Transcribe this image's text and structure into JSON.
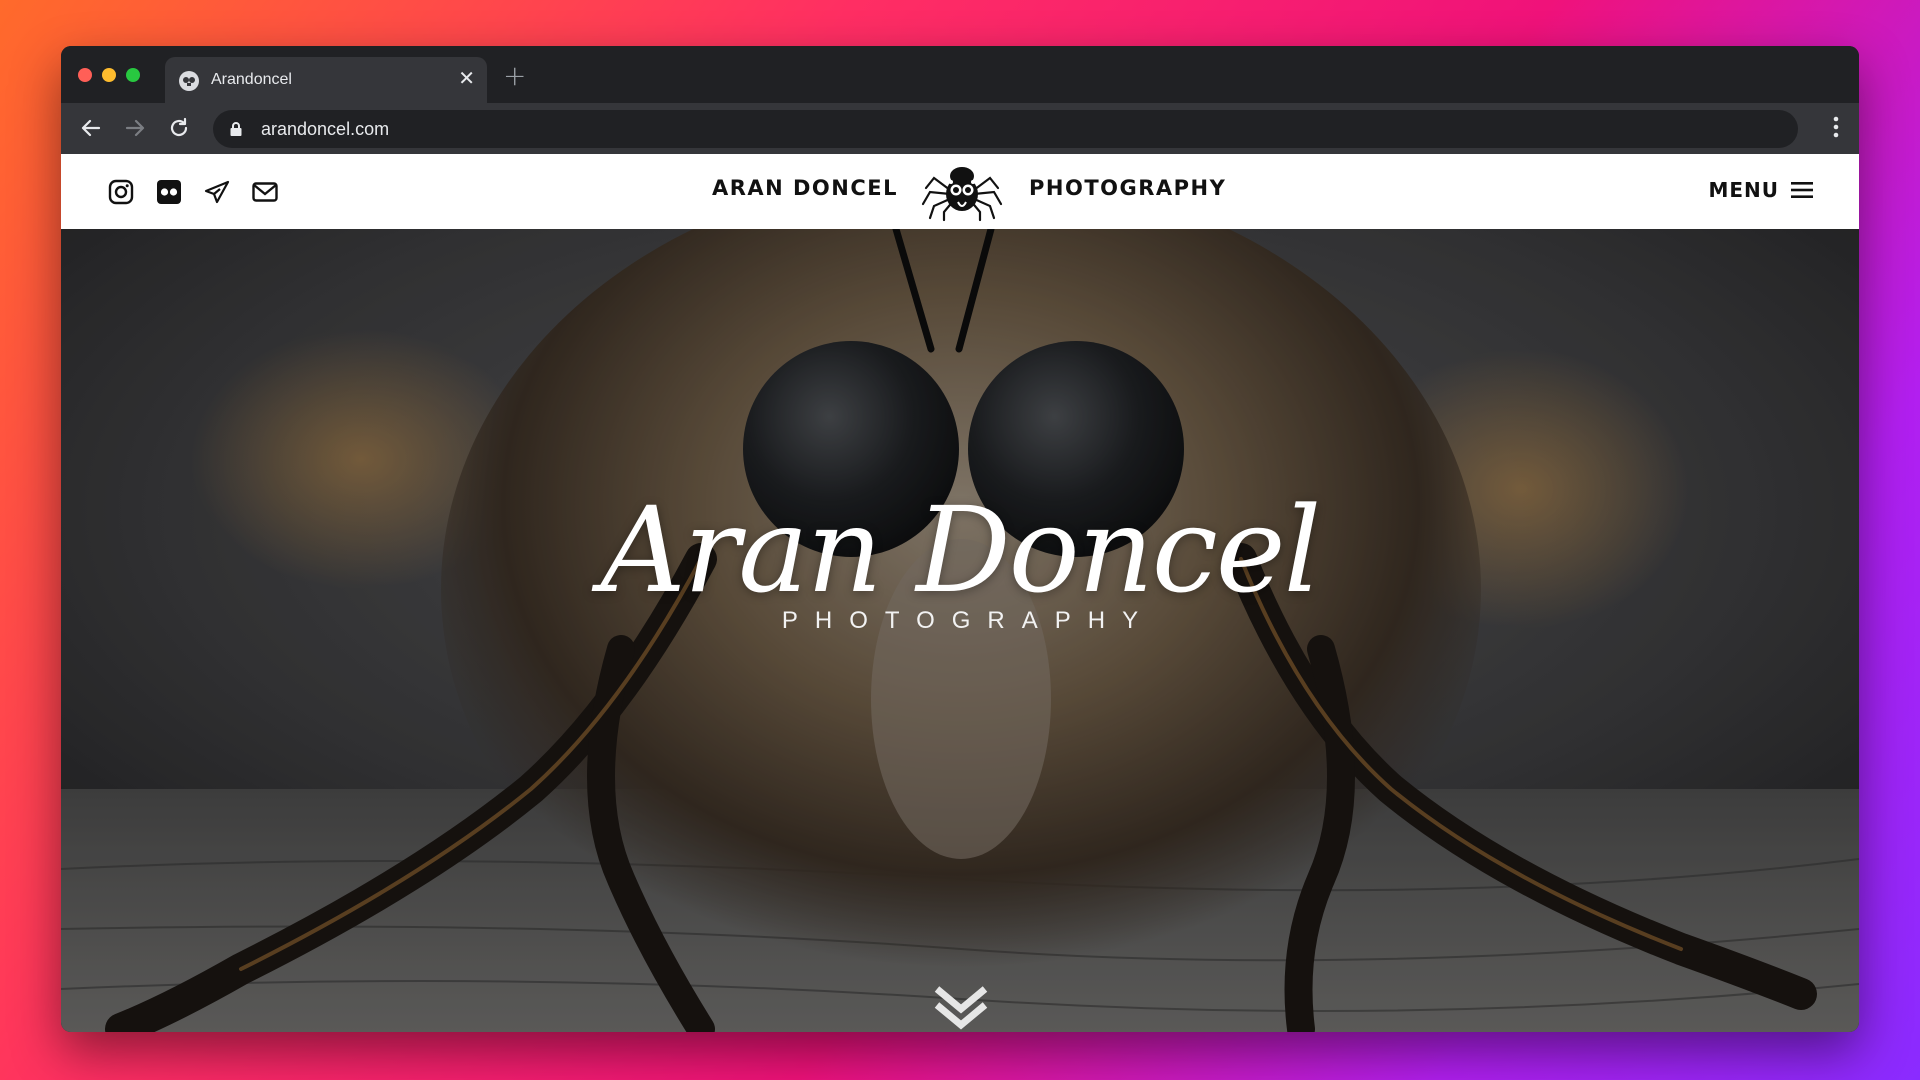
{
  "browser": {
    "tab_title": "Arandoncel",
    "tab_close": "✕",
    "new_tab": "+",
    "url": "arandoncel.com"
  },
  "site": {
    "brand_left": "ARAN DONCEL",
    "brand_right": "PHOTOGRAPHY",
    "menu_label": "MENU",
    "social_icons": [
      "instagram-icon",
      "flickr-icon",
      "telegram-icon",
      "email-icon"
    ]
  },
  "hero": {
    "title": "Aran Doncel",
    "subtitle": "PHOTOGRAPHY"
  },
  "colors": {
    "background_gradient": [
      "#ff6a2b",
      "#ff2e63",
      "#f0127a",
      "#b21ff0",
      "#8a2bff"
    ],
    "browser_chrome": "#202124",
    "header_bg": "#ffffff",
    "brand_text": "#111111"
  }
}
